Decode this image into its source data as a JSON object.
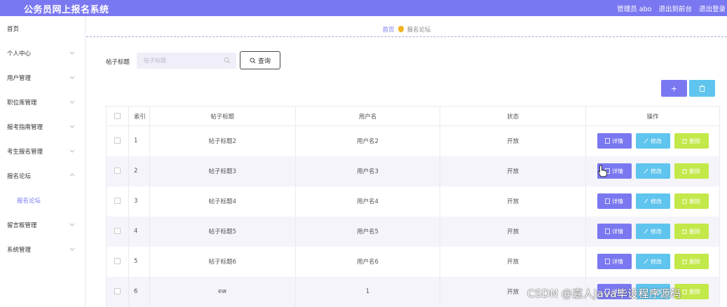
{
  "header": {
    "app_title": "公务员网上报名系统",
    "admin_label": "管理员 abo",
    "to_front": "退出到前台",
    "logout": "退出登录"
  },
  "sidebar": {
    "items": [
      {
        "label": "首页",
        "has_chevron": false
      },
      {
        "label": "个人中心",
        "has_chevron": true
      },
      {
        "label": "用户管理",
        "has_chevron": true
      },
      {
        "label": "职位库管理",
        "has_chevron": true
      },
      {
        "label": "报考指南管理",
        "has_chevron": true
      },
      {
        "label": "考生报名管理",
        "has_chevron": true
      },
      {
        "label": "报名论坛",
        "has_chevron": true
      },
      {
        "label": "报名论坛",
        "has_chevron": false,
        "sub": true
      },
      {
        "label": "留言板管理",
        "has_chevron": true
      },
      {
        "label": "系统管理",
        "has_chevron": true
      }
    ]
  },
  "breadcrumb": {
    "home": "首页",
    "current": "报名论坛"
  },
  "search": {
    "label": "帖子标题",
    "placeholder": "帖子标题",
    "button": "查询"
  },
  "toolbar": {
    "add": "+",
    "delete_icon": "trash-icon"
  },
  "table": {
    "headers": [
      "",
      "索引",
      "帖子标题",
      "用户名",
      "状态",
      "操作"
    ],
    "rows": [
      {
        "index": "1",
        "title": "帖子标题2",
        "user": "用户名2",
        "status": "开放"
      },
      {
        "index": "2",
        "title": "帖子标题3",
        "user": "用户名3",
        "status": "开放"
      },
      {
        "index": "3",
        "title": "帖子标题4",
        "user": "用户名4",
        "status": "开放"
      },
      {
        "index": "4",
        "title": "帖子标题5",
        "user": "用户名5",
        "status": "开放"
      },
      {
        "index": "5",
        "title": "帖子标题6",
        "user": "用户名6",
        "status": "开放"
      },
      {
        "index": "6",
        "title": "ew",
        "user": "1",
        "status": "开放"
      }
    ],
    "ops": {
      "detail": "详情",
      "edit": "修改",
      "delete": "删除"
    }
  },
  "watermark": "CSDN @嘉人Java毕设程序源码",
  "colors": {
    "primary": "#7a78f0",
    "info": "#5fc4ee",
    "lime": "#c3e84a"
  }
}
